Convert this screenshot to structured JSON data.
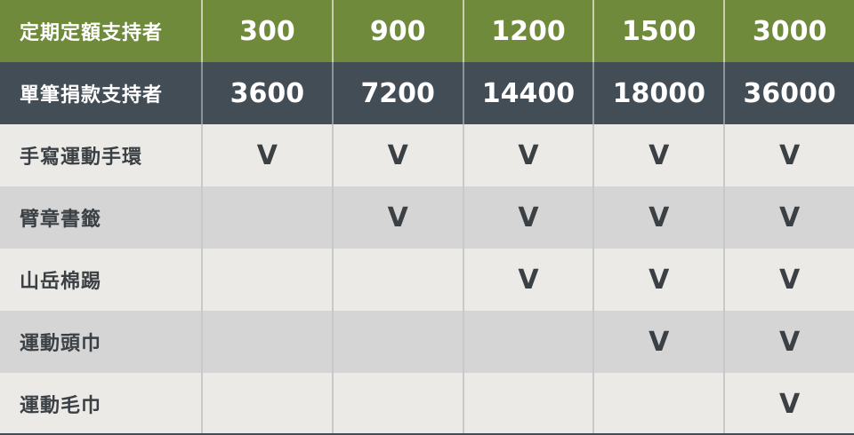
{
  "header_rows": [
    {
      "label": "定期定額支持者",
      "values": [
        "300",
        "900",
        "1200",
        "1500",
        "3000"
      ]
    },
    {
      "label": "單筆捐款支持者",
      "values": [
        "3600",
        "7200",
        "14400",
        "18000",
        "36000"
      ]
    }
  ],
  "reward_rows": [
    {
      "label": "手寫運動手環",
      "marks": [
        "V",
        "V",
        "V",
        "V",
        "V"
      ]
    },
    {
      "label": "臂章書籤",
      "marks": [
        "",
        "V",
        "V",
        "V",
        "V"
      ]
    },
    {
      "label": "山岳棉踢",
      "marks": [
        "",
        "",
        "V",
        "V",
        "V"
      ]
    },
    {
      "label": "運動頭巾",
      "marks": [
        "",
        "",
        "",
        "V",
        "V"
      ]
    },
    {
      "label": "運動毛巾",
      "marks": [
        "",
        "",
        "",
        "",
        "V"
      ]
    }
  ],
  "colors": {
    "header1_bg": "#6f8a3b",
    "header2_bg": "#434d55",
    "row_light": "#eceae6",
    "row_dark": "#d5d5d5",
    "text_dark": "#3b4045"
  }
}
